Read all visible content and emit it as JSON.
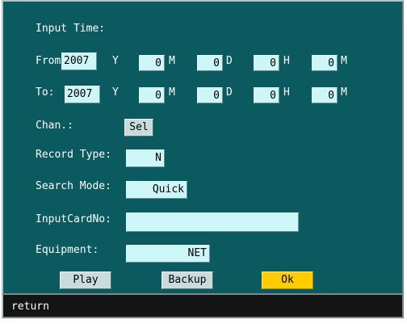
{
  "labels": {
    "input_time": "Input Time:",
    "from": "From",
    "to": "To:",
    "chan": "Chan.:",
    "record_type": "Record Type:",
    "search_mode": "Search Mode:",
    "input_card_no": "InputCardNo:",
    "equipment": "Equipment:",
    "unit_y": "Y",
    "unit_m": "M",
    "unit_d": "D",
    "unit_h": "H",
    "unit_min": "M"
  },
  "from": {
    "year": "2007",
    "month": "0",
    "day": "0",
    "hour": "0",
    "minute": "0"
  },
  "to": {
    "year": "2007",
    "month": "0",
    "day": "0",
    "hour": "0",
    "minute": "0"
  },
  "chan_button": "Sel",
  "record_type_value": "N",
  "search_mode_value": "Quick",
  "input_card_no_value": "",
  "equipment_value": "NET",
  "buttons": {
    "play": "Play",
    "backup": "Backup",
    "ok": "Ok"
  },
  "status_bar": {
    "text": "return"
  },
  "colors": {
    "panel": "#0a5a60",
    "field": "#ccf6f8",
    "ok_button": "#ffcc00",
    "status_bar": "#141414"
  }
}
